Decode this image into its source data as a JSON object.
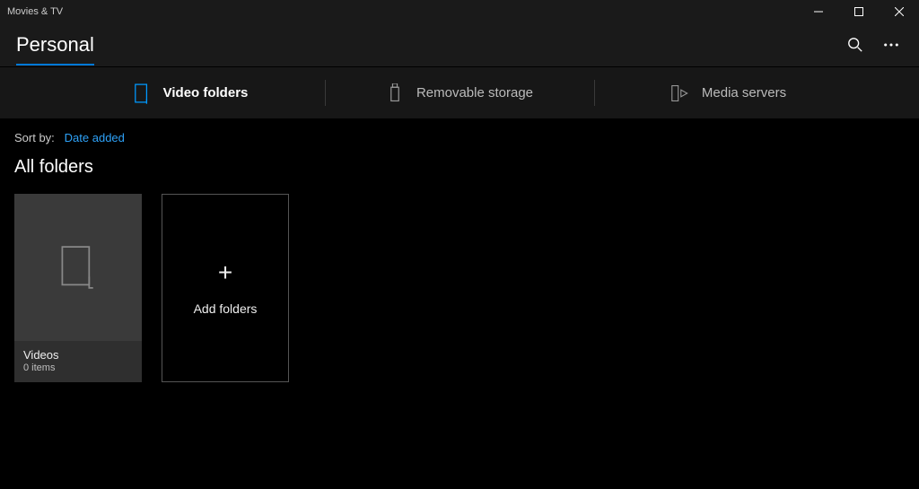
{
  "window": {
    "title": "Movies & TV"
  },
  "header": {
    "page_title": "Personal"
  },
  "tabs": {
    "video_folders": "Video folders",
    "removable_storage": "Removable storage",
    "media_servers": "Media servers"
  },
  "sort": {
    "label": "Sort by:",
    "value": "Date added"
  },
  "section": {
    "title": "All folders"
  },
  "folder": {
    "name": "Videos",
    "count": "0 items"
  },
  "add_tile": {
    "label": "Add folders"
  }
}
